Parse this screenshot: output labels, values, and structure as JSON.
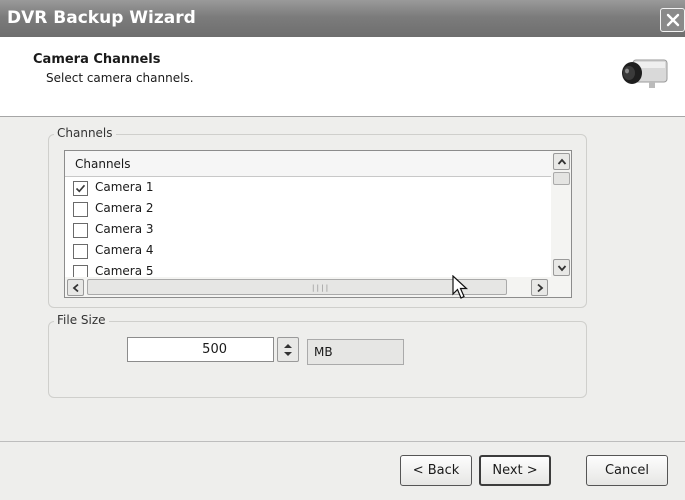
{
  "window": {
    "title": "DVR Backup Wizard"
  },
  "header": {
    "title": "Camera Channels",
    "subtitle": "Select camera channels."
  },
  "channels_group": {
    "label": "Channels",
    "column_header": "Channels",
    "items": [
      {
        "label": "Camera 1",
        "checked": true
      },
      {
        "label": "Camera 2",
        "checked": false
      },
      {
        "label": "Camera 3",
        "checked": false
      },
      {
        "label": "Camera 4",
        "checked": false
      },
      {
        "label": "Camera 5",
        "checked": false
      }
    ]
  },
  "file_size_group": {
    "label": "File Size",
    "value": "500",
    "unit": "MB"
  },
  "buttons": {
    "back": "< Back",
    "next": "Next >",
    "cancel": "Cancel"
  },
  "icons": {
    "close": "close-icon",
    "camera": "camera-icon",
    "cursor": "mouse-pointer-icon"
  }
}
